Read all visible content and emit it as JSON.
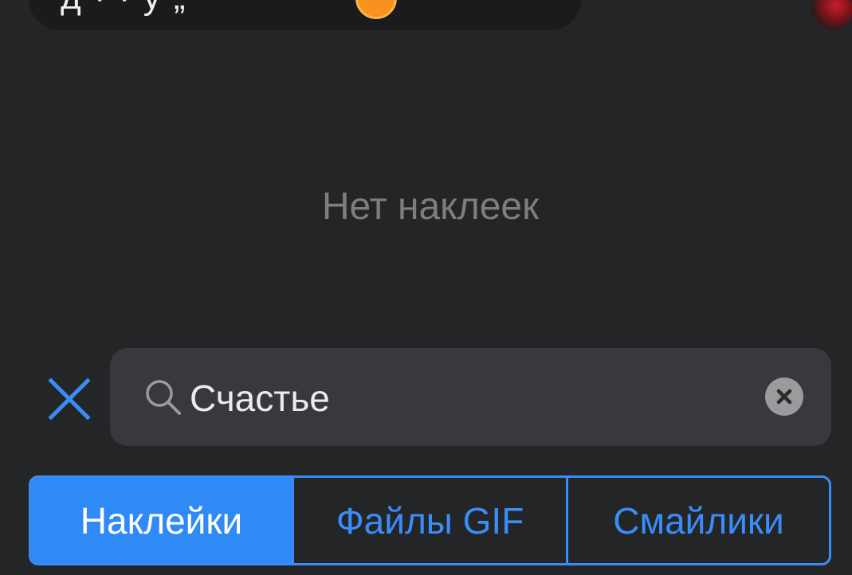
{
  "chat": {
    "bubble_text": "д  ·  ·  у „"
  },
  "results": {
    "empty_message": "Нет наклеек"
  },
  "search": {
    "value": "Счастье",
    "placeholder": ""
  },
  "tabs": [
    {
      "label": "Наклейки",
      "selected": true
    },
    {
      "label": "Файлы GIF",
      "selected": false
    },
    {
      "label": "Смайлики",
      "selected": false
    }
  ],
  "colors": {
    "background": "#242527",
    "accent": "#2f8af5",
    "search_background": "#38393c",
    "empty_text": "#7d7e80"
  },
  "icons": {
    "close": "close-icon",
    "search": "search-icon",
    "clear": "clear-icon",
    "emoji": "smiling-emoji-icon"
  }
}
